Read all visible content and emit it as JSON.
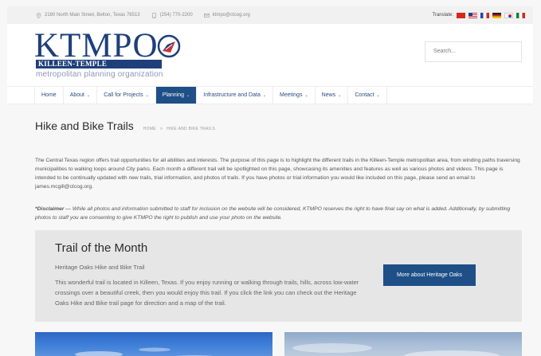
{
  "topbar": {
    "address": "2180 North Main Street, Belton, Texas 76513",
    "phone": "(254) 770-2200",
    "email": "ktmpo@ctcog.org",
    "translate_label": "Translate:"
  },
  "header": {
    "logo_main": "KTMPO",
    "logo_band": "KILLEEN-TEMPLE",
    "logo_sub": "metropolitan planning organization",
    "search_placeholder": "Search..."
  },
  "nav": {
    "items": [
      {
        "label": "Home",
        "dropdown": false
      },
      {
        "label": "About",
        "dropdown": true
      },
      {
        "label": "Call for Projects",
        "dropdown": true
      },
      {
        "label": "Planning",
        "dropdown": true,
        "active": true
      },
      {
        "label": "Infrastructure and Data",
        "dropdown": true
      },
      {
        "label": "Meetings",
        "dropdown": true
      },
      {
        "label": "News",
        "dropdown": true
      },
      {
        "label": "Contact",
        "dropdown": true
      }
    ],
    "caret": "⌄"
  },
  "page": {
    "title": "Hike and Bike Trails",
    "breadcrumb_home": "HOME",
    "breadcrumb_sep": ">",
    "breadcrumb_current": "HIKE AND BIKE TRAILS",
    "intro": "The Central Texas region offers trail opportunities for all abilities and interests. The purpose of this page is to highlight the different trails in the Killeen-Temple metropolitan area, from winding paths traversing municipalities to walking loops around City parks. Each month a different trail will be spotlighted on this page, showcasing its amenities and features as well as various photos and videos. This page is intended to be continually updated with new trails, trial information, and photos of trails. If you have photos or trial information you would like included on this page, please send an email to james.mcgill@ctcog.org.",
    "disclaimer_label": "*Disclaimer",
    "disclaimer_text": " — While all photos and information submitted to staff for inclusion on the website will be considered, KTMPO reserves the right to have final say on what is added. Additionally, by submitting photos to staff you are consenting to give KTMPO the right to publish and use your photo on the website."
  },
  "trail_of_month": {
    "heading": "Trail of the Month",
    "trail_name": "Heritage Oaks Hike and Bike Trail",
    "description": "This wonderful trail is located in Killeen, Texas. If you enjoy running or walking through trails, hills, across low-water crossings over a beautiful creek, then you would enjoy this trail. If you click the link you can check out the Heritage Oaks Hike and Bike trail page for direction and a map of the trail.",
    "button_label": "More about Heritage Oaks"
  },
  "colors": {
    "brand_blue": "#1e4f86",
    "logo_blue": "#1e3f7a"
  },
  "icons": [
    "map-marker-icon",
    "phone-icon",
    "envelope-icon"
  ]
}
